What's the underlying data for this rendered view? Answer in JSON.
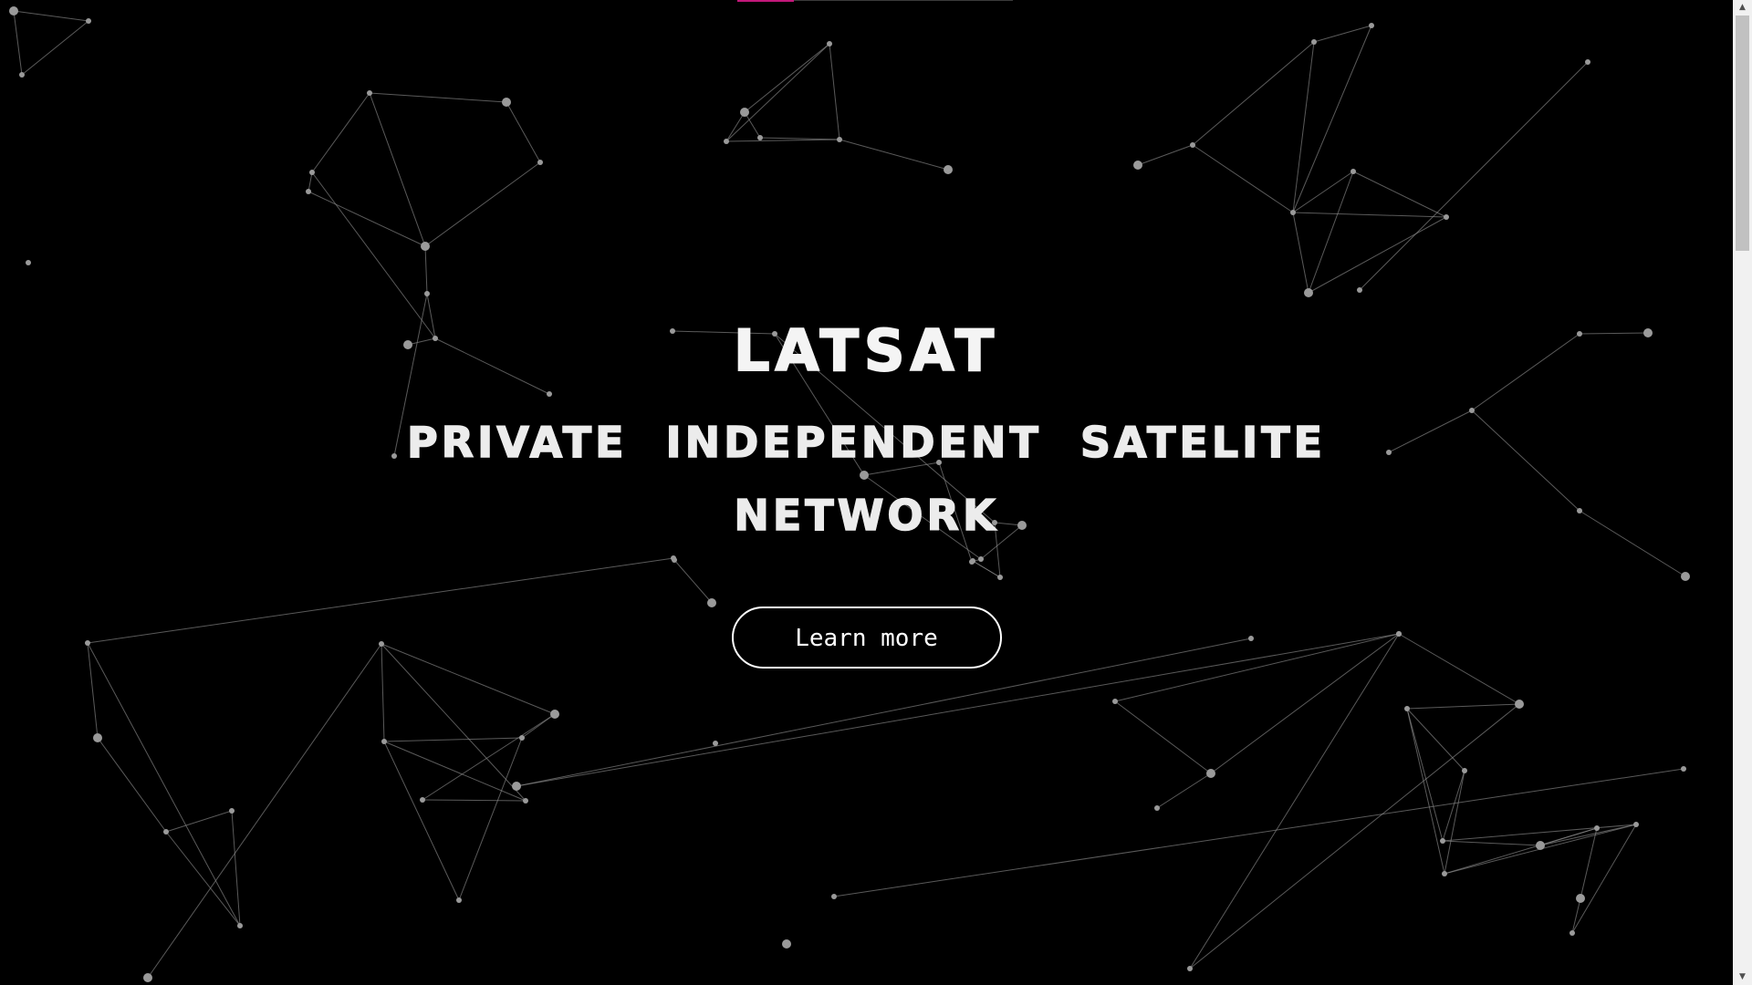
{
  "hero": {
    "title": "LATSAT",
    "subtitle": "PRIVATE INDEPENDENT SATELITE NETWORK",
    "cta_label": "Learn more"
  },
  "colors": {
    "background": "#000000",
    "text": "#f2f2f2",
    "network_lines": "#8a8a8a",
    "network_nodes": "#9a9a9a",
    "accent_progress": "#c2187a"
  },
  "icons": {
    "scroll_up": "▲",
    "scroll_down": "▼"
  },
  "background_animation": "particle-network"
}
